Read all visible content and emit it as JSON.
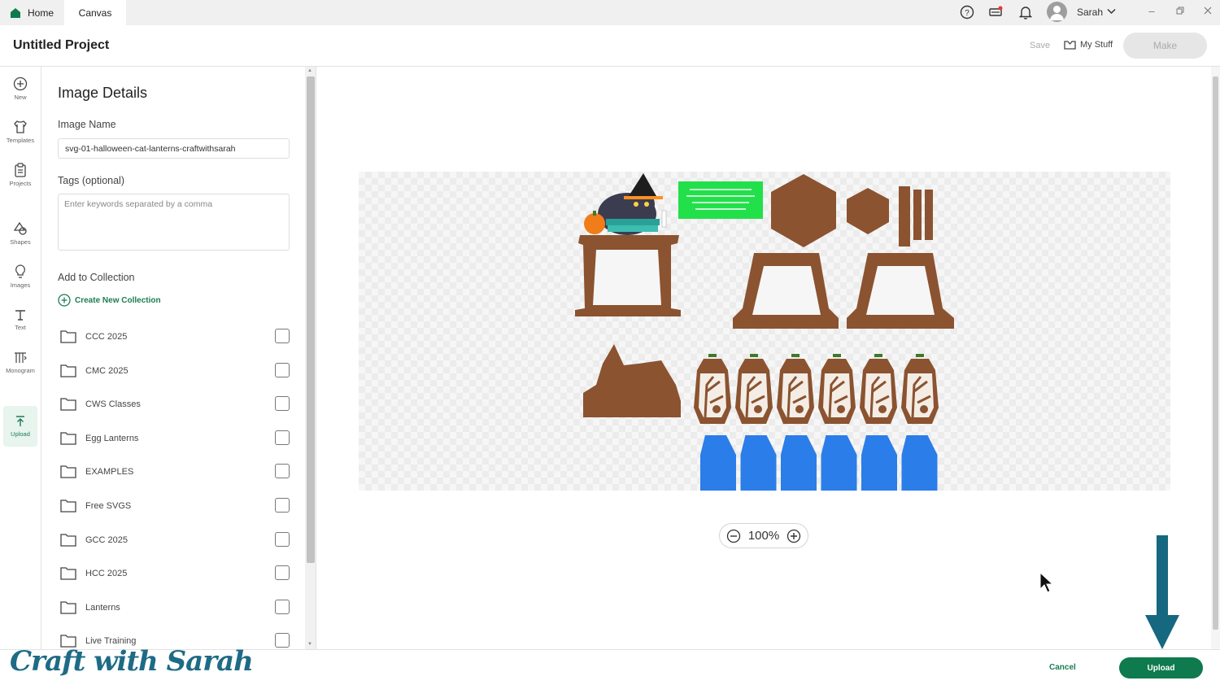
{
  "tabs": {
    "home": "Home",
    "canvas": "Canvas"
  },
  "user": {
    "name": "Sarah"
  },
  "header": {
    "project_title": "Untitled Project",
    "save": "Save",
    "my_stuff": "My Stuff",
    "make": "Make"
  },
  "rail": [
    {
      "label": "New",
      "icon": "plus-circle-icon"
    },
    {
      "label": "Templates",
      "icon": "shirt-icon"
    },
    {
      "label": "Projects",
      "icon": "clipboard-icon"
    },
    {
      "label": "Shapes",
      "icon": "shapes-icon"
    },
    {
      "label": "Images",
      "icon": "lightbulb-icon"
    },
    {
      "label": "Text",
      "icon": "text-icon"
    },
    {
      "label": "Monogram",
      "icon": "monogram-icon"
    },
    {
      "label": "Upload",
      "icon": "upload-icon"
    }
  ],
  "panel": {
    "title": "Image Details",
    "image_name_label": "Image Name",
    "image_name_value": "svg-01-halloween-cat-lanterns-craftwithsarah",
    "tags_label": "Tags (optional)",
    "tags_placeholder": "Enter keywords separated by a comma",
    "collection_label": "Add to Collection",
    "create_collection": "Create New Collection",
    "collections": [
      "CCC 2025",
      "CMC 2025",
      "CWS Classes",
      "Egg Lanterns",
      "EXAMPLES",
      "Free SVGS",
      "GCC 2025",
      "HCC 2025",
      "Lanterns",
      "Live Training"
    ]
  },
  "canvas": {
    "zoom": "100%"
  },
  "footer": {
    "cancel": "Cancel",
    "upload": "Upload"
  },
  "watermark": "Craft with Sarah",
  "colors": {
    "accent": "#0e7a4e",
    "brown": "#8b5330",
    "blue": "#2b7de9",
    "green_note": "#22e04a",
    "arrow": "#15687f"
  }
}
